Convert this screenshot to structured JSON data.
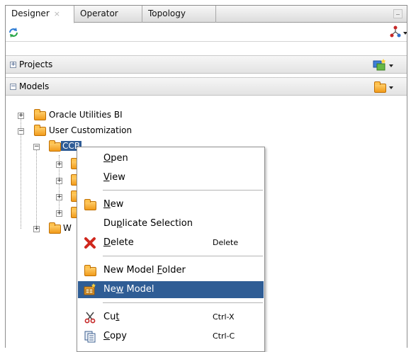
{
  "tabs": [
    {
      "label": "Designer",
      "close": "×"
    },
    {
      "label": "Operator"
    },
    {
      "label": "Topology"
    }
  ],
  "sections": {
    "projects": {
      "label": "Projects",
      "toggle": "+"
    },
    "models": {
      "label": "Models",
      "toggle": "−"
    }
  },
  "tree": {
    "nodes": [
      {
        "label": "Oracle Utilities BI",
        "toggle": "+"
      },
      {
        "label": "User Customization",
        "toggle": "−"
      },
      {
        "label": "CCB",
        "toggle": "−"
      },
      {
        "label": "",
        "toggle": "+"
      },
      {
        "label": "",
        "toggle": "+"
      },
      {
        "label": "",
        "toggle": "+"
      },
      {
        "label": "",
        "toggle": "+"
      },
      {
        "label": "W",
        "toggle": "+"
      }
    ]
  },
  "context_menu": {
    "open": {
      "pre": "",
      "key": "O",
      "post": "pen"
    },
    "view": {
      "pre": "",
      "key": "V",
      "post": "iew"
    },
    "new": {
      "pre": "",
      "key": "N",
      "post": "ew"
    },
    "duplicate": {
      "pre": "Du",
      "key": "p",
      "post": "licate Selection"
    },
    "delete": {
      "pre": "",
      "key": "D",
      "post": "elete",
      "shortcut": "Delete"
    },
    "new_model_folder": {
      "pre": "New Model ",
      "key": "F",
      "post": "older"
    },
    "new_model": {
      "pre": "Ne",
      "key": "w",
      "post": " Model"
    },
    "cut": {
      "pre": "Cu",
      "key": "t",
      "post": "",
      "shortcut": "Ctrl-X"
    },
    "copy": {
      "pre": "",
      "key": "C",
      "post": "opy",
      "shortcut": "Ctrl-C"
    }
  },
  "colors": {
    "selection": "#2f5d95",
    "folder": "#f19b1b",
    "delete_icon": "#d0281e"
  }
}
